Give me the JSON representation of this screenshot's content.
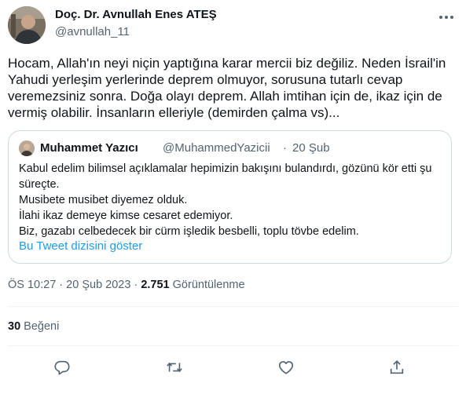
{
  "author": {
    "name": "Doç. Dr. Avnullah Enes ATEŞ",
    "handle": "@avnullah_11"
  },
  "tweet": {
    "text": "Hocam, Allah'ın neyi niçin yaptığına karar mercii biz değiliz. Neden İsrail'in Yahudi yerleşim yerlerinde deprem olmuyor, sorusuna tutarlı cevap veremezsiniz sonra. Doğa olayı deprem. Allah imtihan için de, ikaz için de vermiş olabilir. İnsanların elleriyle (demirden çalma vs)..."
  },
  "quote": {
    "name": "Muhammet Yazıcı",
    "handle": "@MuhammedYazicii",
    "separator": "·",
    "date": "20 Şub",
    "lines": [
      "Kabul edelim bilimsel açıklamalar hepimizin bakışını bulandırdı, gözünü kör etti şu süreçte.",
      "Musibete musibet diyemez olduk.",
      "İlahi ikaz demeye kimse cesaret edemiyor.",
      "Biz, gazabı celbedecek bir cürm işledik besbelli, toplu tövbe edelim."
    ],
    "show_thread": "Bu Tweet dizisini göster"
  },
  "meta": {
    "time": "ÖS 10:27",
    "separator": "·",
    "date": "20 Şub 2023",
    "views_count": "2.751",
    "views_label": "Görüntülenme"
  },
  "stats": {
    "likes_count": "30",
    "likes_label": "Beğeni"
  },
  "icons": {
    "more": "more-dots-icon",
    "reply": "reply-icon",
    "retweet": "retweet-icon",
    "like": "heart-icon",
    "share": "share-icon"
  },
  "colors": {
    "link": "#1d9bf0",
    "secondary_text": "#536471",
    "primary_text": "#0f1419",
    "border": "#cfd9de"
  }
}
